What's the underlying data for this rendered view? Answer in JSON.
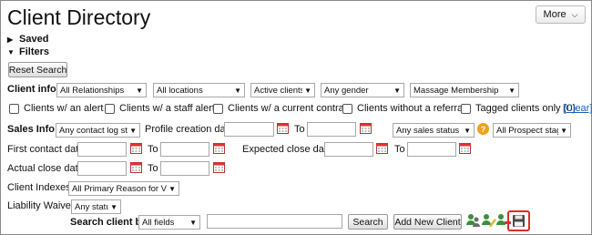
{
  "header": {
    "title": "Client Directory",
    "more_label": "More"
  },
  "sections": {
    "saved": "Saved",
    "filters": "Filters"
  },
  "reset_label": "Reset Search",
  "client_info": {
    "label": "Client info:",
    "relationships": "All Relationships",
    "locations": "All locations",
    "status": "Active clients",
    "gender": "Any gender",
    "membership": "Massage Membership"
  },
  "checks": {
    "alert": "Clients w/ an alert",
    "staff_alert": "Clients w/ a staff alert",
    "contract": "Clients w/ a current contract",
    "referral": "Clients without a referral",
    "tagged": "Tagged clients only (0)",
    "clear": "[Clear]"
  },
  "sales_info": {
    "label": "Sales Info:",
    "contact_log": "Any contact log status",
    "profile_label": "Profile creation date:",
    "to": "To",
    "sales_status": "Any sales status",
    "help": "?",
    "prospect": "All Prospect stages"
  },
  "dates": {
    "first_contact": "First contact date:",
    "expected_close": "Expected close date:",
    "actual_close": "Actual close date:",
    "to": "To"
  },
  "client_indexes": {
    "label": "Client Indexes:",
    "value": "All Primary Reason for Visiting"
  },
  "liability": {
    "label": "Liability Waiver:",
    "value": "Any status"
  },
  "search": {
    "label": "Search client by",
    "field": "All fields",
    "query": "",
    "search_label": "Search",
    "add_label": "Add New Client"
  },
  "colors": {
    "accent": "#e02a2a",
    "help": "#f0a018",
    "link": "#1a5fb4"
  }
}
